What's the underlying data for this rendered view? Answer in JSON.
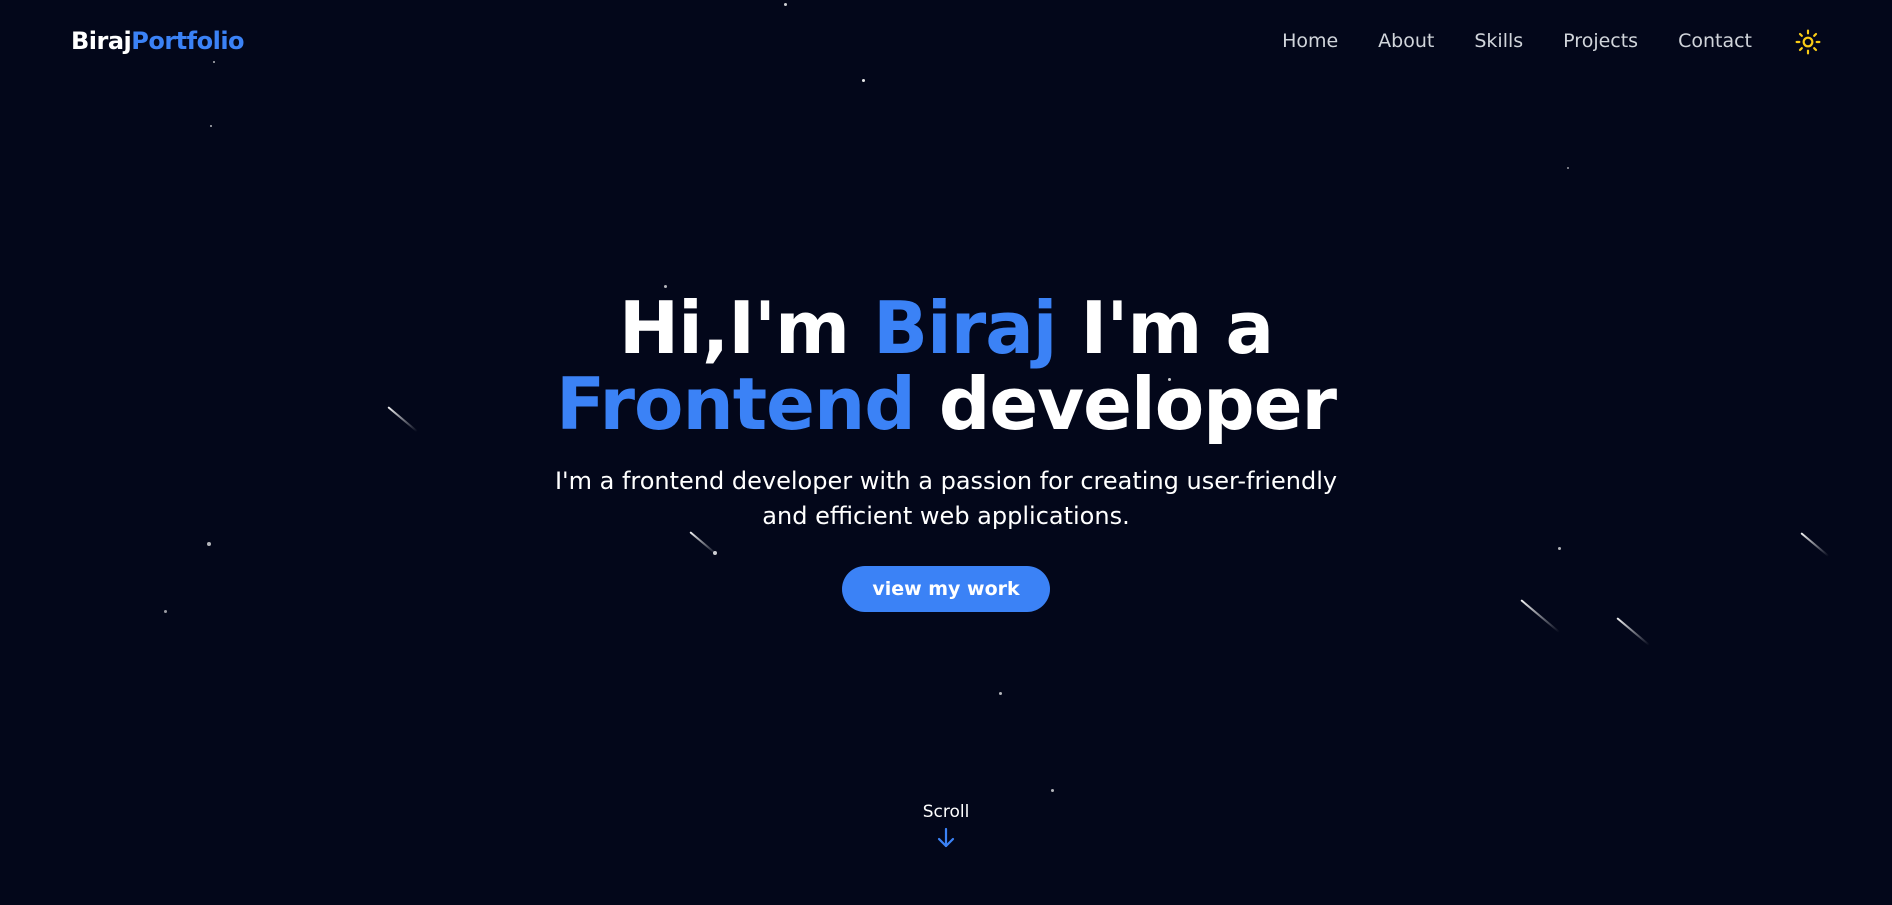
{
  "navbar": {
    "logo_first": "Biraj",
    "logo_second": "Portfolio",
    "links": [
      "Home",
      "About",
      "Skills",
      "Projects",
      "Contact"
    ],
    "theme_icon": "sun-icon"
  },
  "hero": {
    "title_part1": "Hi,I'm ",
    "title_name": "Biraj",
    "title_part2": " I'm a ",
    "title_role": "Frontend",
    "title_part3": " developer",
    "subtitle": "I'm a frontend developer with a passion for creating user-friendly and efficient web applications.",
    "cta_label": "view my work"
  },
  "scroll": {
    "label": "Scroll",
    "icon": "arrow-down-icon"
  },
  "colors": {
    "background": "#03071a",
    "accent": "#3b82f6",
    "sun": "#facc15"
  }
}
